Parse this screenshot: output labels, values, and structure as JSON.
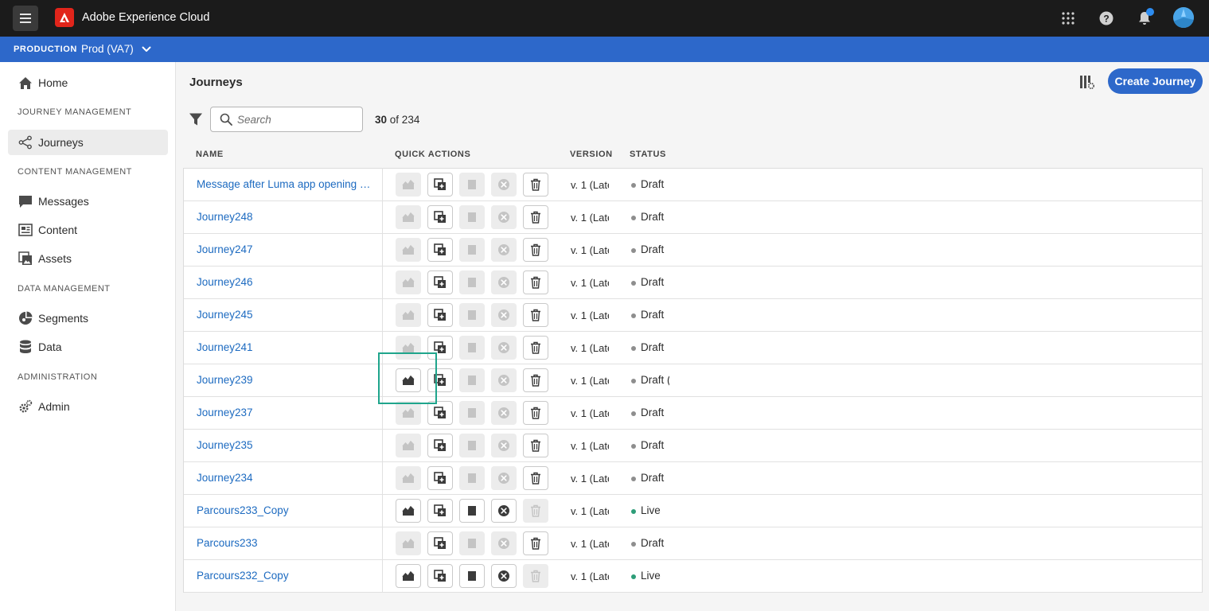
{
  "header": {
    "app_name": "Adobe Experience Cloud",
    "icons": [
      "menu-icon",
      "adobe-logo",
      "apps-grid-icon",
      "help-icon",
      "bell-icon",
      "avatar"
    ],
    "brand_color": "#e1251b",
    "notification_dot_color": "#2d8cf0"
  },
  "env": {
    "label": "PRODUCTION",
    "name": "Prod (VA7)",
    "bar_color": "#2d68ca"
  },
  "sidebar": {
    "home": "Home",
    "sections": {
      "journey_management": "JOURNEY MANAGEMENT",
      "content_management": "CONTENT MANAGEMENT",
      "data_management": "DATA MANAGEMENT",
      "administration": "ADMINISTRATION"
    },
    "items": {
      "journeys": "Journeys",
      "messages": "Messages",
      "content": "Content",
      "assets": "Assets",
      "segments": "Segments",
      "data": "Data",
      "admin": "Admin"
    },
    "active_item": "Journeys"
  },
  "main": {
    "title": "Journeys",
    "create_button": "Create Journey",
    "search_placeholder": "Search",
    "count_shown": "30",
    "count_total": "of 234",
    "columns": {
      "name": "NAME",
      "quick_actions": "QUICK ACTIONS",
      "version": "VERSION",
      "status": "STATUS"
    }
  },
  "status_colors": {
    "Draft": "#8e8e8e",
    "Live": "#2d9d78"
  },
  "rows": [
    {
      "name": "Message after Luma app opening an...",
      "version": "v. 1 (Late",
      "status": "Draft",
      "quick_actions_enabled": [
        "duplicate",
        "delete"
      ]
    },
    {
      "name": "Journey248",
      "version": "v. 1 (Late",
      "status": "Draft",
      "quick_actions_enabled": [
        "duplicate",
        "delete"
      ]
    },
    {
      "name": "Journey247",
      "version": "v. 1 (Late",
      "status": "Draft",
      "quick_actions_enabled": [
        "duplicate",
        "delete"
      ]
    },
    {
      "name": "Journey246",
      "version": "v. 1 (Late",
      "status": "Draft",
      "quick_actions_enabled": [
        "duplicate",
        "delete"
      ]
    },
    {
      "name": "Journey245",
      "version": "v. 1 (Late",
      "status": "Draft",
      "quick_actions_enabled": [
        "duplicate",
        "delete"
      ]
    },
    {
      "name": "Journey241",
      "version": "v. 1 (Late",
      "status": "Draft",
      "quick_actions_enabled": [
        "duplicate",
        "delete"
      ]
    },
    {
      "name": "Journey239",
      "version": "v. 1 (Late",
      "status": "Draft (",
      "quick_actions_enabled": [
        "report",
        "duplicate",
        "delete"
      ]
    },
    {
      "name": "Journey237",
      "version": "v. 1 (Late",
      "status": "Draft",
      "quick_actions_enabled": [
        "duplicate",
        "delete"
      ]
    },
    {
      "name": "Journey235",
      "version": "v. 1 (Late",
      "status": "Draft",
      "quick_actions_enabled": [
        "duplicate",
        "delete"
      ]
    },
    {
      "name": "Journey234",
      "version": "v. 1 (Late",
      "status": "Draft",
      "quick_actions_enabled": [
        "duplicate",
        "delete"
      ]
    },
    {
      "name": "Parcours233_Copy",
      "version": "v. 1 (Late",
      "status": "Live",
      "quick_actions_enabled": [
        "report",
        "duplicate",
        "stop",
        "close"
      ]
    },
    {
      "name": "Parcours233",
      "version": "v. 1 (Late",
      "status": "Draft",
      "quick_actions_enabled": [
        "duplicate",
        "delete"
      ]
    },
    {
      "name": "Parcours232_Copy",
      "version": "v. 1 (Late",
      "status": "Live",
      "quick_actions_enabled": [
        "report",
        "duplicate",
        "stop",
        "close"
      ]
    }
  ]
}
